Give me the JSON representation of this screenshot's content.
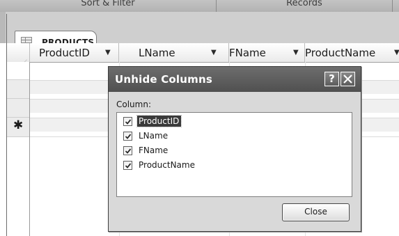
{
  "ribbon": {
    "groups": [
      {
        "label": "Sort & Filter"
      },
      {
        "label": "Records"
      }
    ]
  },
  "tab": {
    "label": "PRODUCTS",
    "icon": "table-icon"
  },
  "datasheet": {
    "columns": [
      {
        "label": "ProductID"
      },
      {
        "label": "LName"
      },
      {
        "label": "FName"
      },
      {
        "label": "ProductName"
      }
    ],
    "dropdown_glyph": "▼",
    "new_record_marker": "✱"
  },
  "dialog": {
    "title": "Unhide Columns",
    "help_glyph": "?",
    "column_label": "Column:",
    "items": [
      {
        "label": "ProductID",
        "checked": true,
        "selected": true
      },
      {
        "label": "LName",
        "checked": true,
        "selected": false
      },
      {
        "label": "FName",
        "checked": true,
        "selected": false
      },
      {
        "label": "ProductName",
        "checked": true,
        "selected": false
      }
    ],
    "close_label": "Close"
  },
  "colors": {
    "title_bar": "#5a5a5a",
    "dialog_body": "#d9d9d9",
    "selection": "#3a3a3a"
  }
}
